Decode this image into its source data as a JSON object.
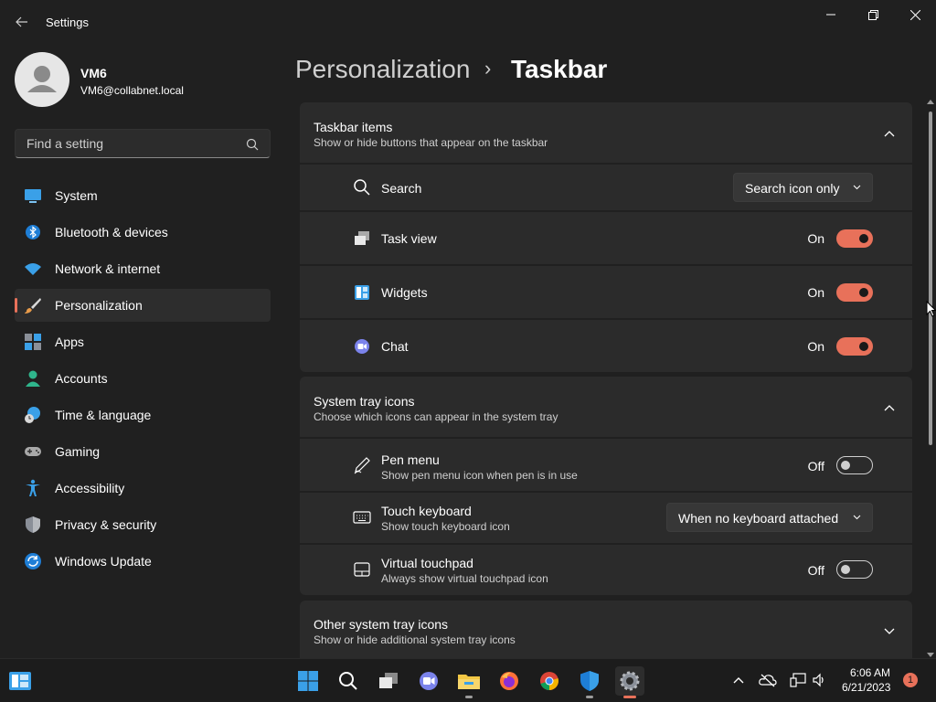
{
  "window": {
    "title": "Settings",
    "controls": {
      "minimize": "minimize-icon",
      "maximize": "restore-icon",
      "close": "close-icon"
    }
  },
  "user": {
    "name": "VM6",
    "email": "VM6@collabnet.local"
  },
  "search": {
    "placeholder": "Find a setting"
  },
  "nav": {
    "items": [
      {
        "label": "System",
        "icon": "system-icon"
      },
      {
        "label": "Bluetooth & devices",
        "icon": "bluetooth-icon"
      },
      {
        "label": "Network & internet",
        "icon": "wifi-icon"
      },
      {
        "label": "Personalization",
        "icon": "brush-icon",
        "active": true
      },
      {
        "label": "Apps",
        "icon": "apps-icon"
      },
      {
        "label": "Accounts",
        "icon": "accounts-icon"
      },
      {
        "label": "Time & language",
        "icon": "clock-globe-icon"
      },
      {
        "label": "Gaming",
        "icon": "gamepad-icon"
      },
      {
        "label": "Accessibility",
        "icon": "accessibility-icon"
      },
      {
        "label": "Privacy & security",
        "icon": "shield-icon"
      },
      {
        "label": "Windows Update",
        "icon": "update-icon"
      }
    ]
  },
  "breadcrumb": {
    "parent": "Personalization",
    "separator": "›",
    "current": "Taskbar"
  },
  "sections": {
    "taskbar_items": {
      "title": "Taskbar items",
      "subtitle": "Show or hide buttons that appear on the taskbar",
      "rows": {
        "search": {
          "label": "Search",
          "value": "Search icon only"
        },
        "task_view": {
          "label": "Task view",
          "state": "On"
        },
        "widgets": {
          "label": "Widgets",
          "state": "On"
        },
        "chat": {
          "label": "Chat",
          "state": "On"
        }
      }
    },
    "system_tray": {
      "title": "System tray icons",
      "subtitle": "Choose which icons can appear in the system tray",
      "rows": {
        "pen_menu": {
          "label": "Pen menu",
          "desc": "Show pen menu icon when pen is in use",
          "state": "Off"
        },
        "touch_keyboard": {
          "label": "Touch keyboard",
          "desc": "Show touch keyboard icon",
          "value": "When no keyboard attached"
        },
        "virtual_touchpad": {
          "label": "Virtual touchpad",
          "desc": "Always show virtual touchpad icon",
          "state": "Off"
        }
      }
    },
    "other_tray": {
      "title": "Other system tray icons",
      "subtitle": "Show or hide additional system tray icons"
    }
  },
  "taskbar": {
    "apps": [
      "windows-start-icon",
      "search-icon",
      "task-view-icon",
      "chat-icon",
      "file-explorer-icon",
      "firefox-icon",
      "chrome-icon",
      "defender-icon",
      "settings-icon"
    ],
    "clock": {
      "time": "6:06 AM",
      "date": "6/21/2023"
    },
    "notifications": "1"
  },
  "colors": {
    "accent": "#e8715a",
    "background": "#202020",
    "card": "#2b2b2b"
  }
}
